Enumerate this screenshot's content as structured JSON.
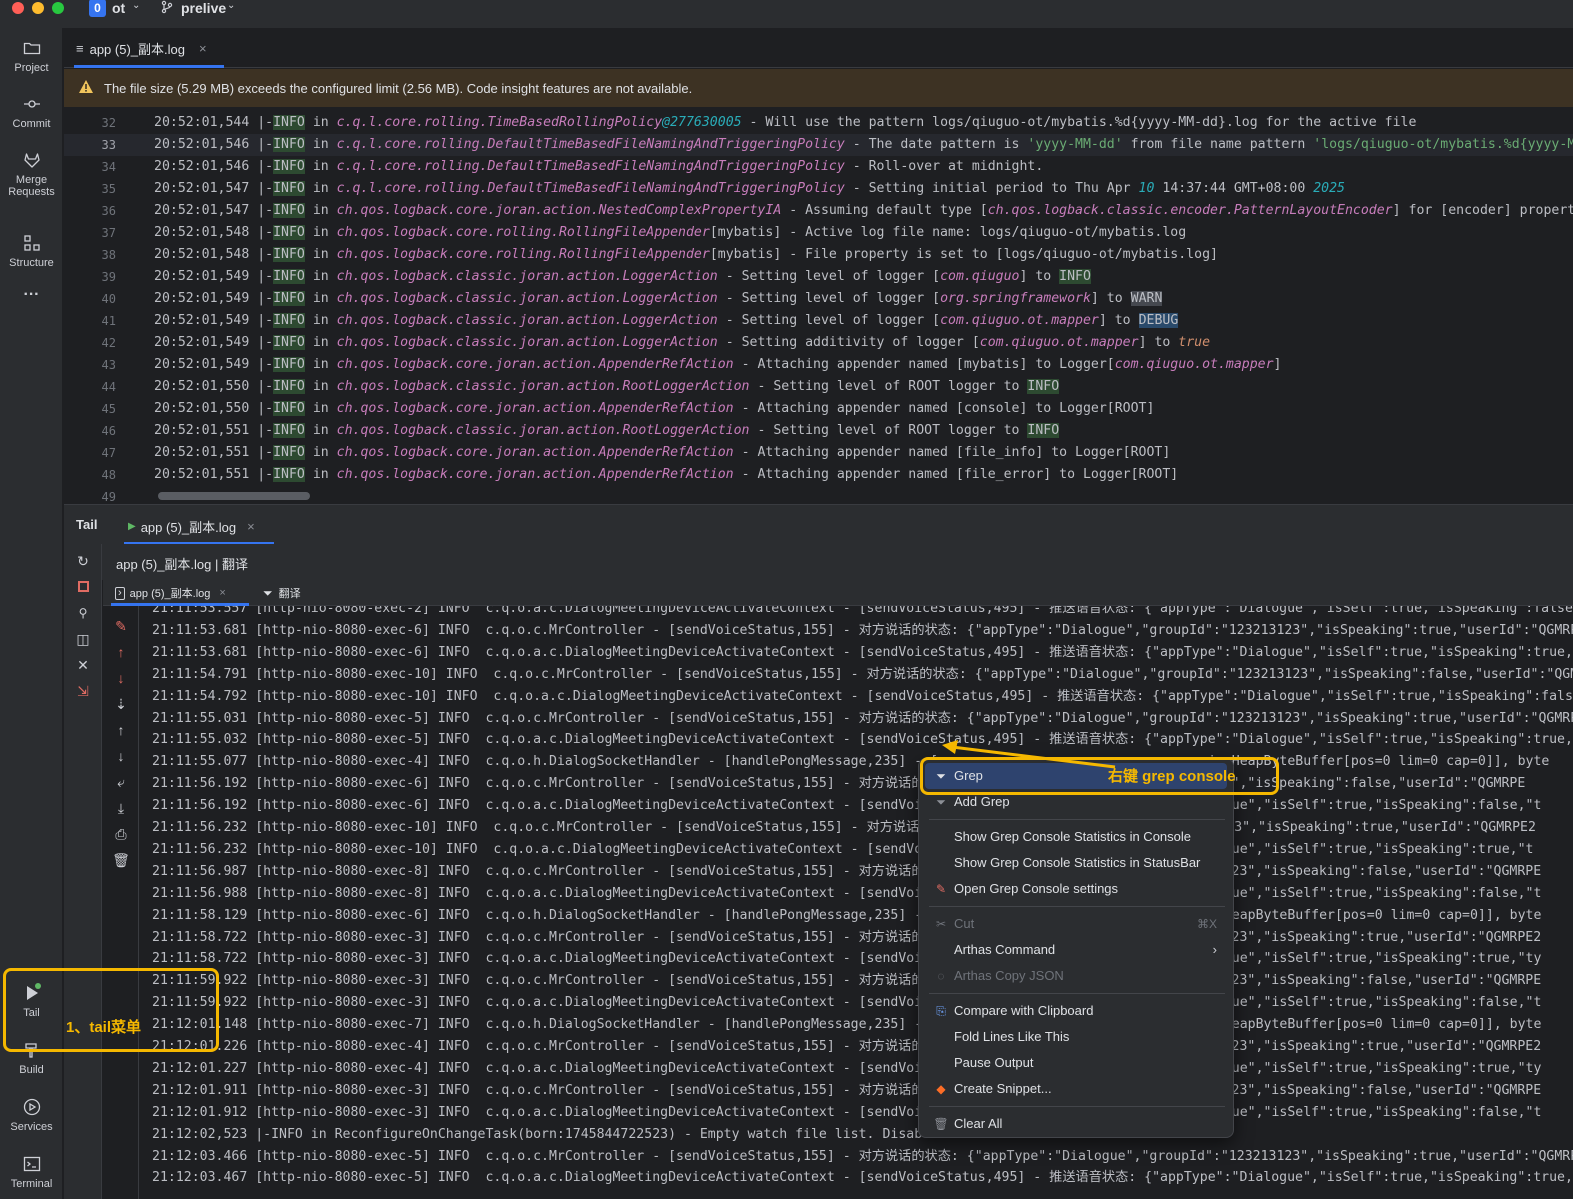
{
  "titlebar": {
    "project_badge": "0",
    "project_name": "ot",
    "branch": "prelive"
  },
  "toolstripe": {
    "project": "Project",
    "commit": "Commit",
    "merge_requests_1": "Merge",
    "merge_requests_2": "Requests",
    "structure": "Structure",
    "more": "···",
    "tail": "Tail",
    "build": "Build",
    "services": "Services",
    "terminal": "Terminal"
  },
  "editor_tab": {
    "label": "app (5)_副本.log"
  },
  "warning": {
    "text": "The file size (5.29 MB) exceeds the configured limit (2.56 MB). Code insight features are not available."
  },
  "editor_lines": [
    {
      "n": "32",
      "t": "20:52:01,544",
      "cls": "c.q.l.core.rolling.TimeBasedRollingPolicy",
      "num": "@277630005",
      "msg": " - Will use the pattern logs/qiuguo-ot/mybatis.%d{yyyy-MM-dd}.log for the active file"
    },
    {
      "n": "33",
      "t": "20:52:01,546",
      "cls": "c.q.l.core.rolling.DefaultTimeBasedFileNamingAndTriggeringPolicy",
      "msg": " - The date pattern is ",
      "s1": "'yyyy-MM-dd'",
      "msg2": " from file name pattern ",
      "s2": "'logs/qiuguo-ot/mybatis.%d{yyyy-MM-d"
    },
    {
      "n": "34",
      "t": "20:52:01,546",
      "cls": "c.q.l.core.rolling.DefaultTimeBasedFileNamingAndTriggeringPolicy",
      "msg": " - Roll-over at midnight."
    },
    {
      "n": "35",
      "t": "20:52:01,547",
      "cls": "c.q.l.core.rolling.DefaultTimeBasedFileNamingAndTriggeringPolicy",
      "msg": " - Setting initial period to Thu Apr ",
      "num1": "10",
      "msg2": " 14:37:44 GMT+08:00 ",
      "num2": "2025"
    },
    {
      "n": "36",
      "t": "20:52:01,547",
      "cls": "ch.qos.logback.core.joran.action.NestedComplexPropertyIA",
      "msg": " - Assuming default type [",
      "cls2": "ch.qos.logback.classic.encoder.PatternLayoutEncoder",
      "msg2": "] for [encoder] property"
    },
    {
      "n": "37",
      "t": "20:52:01,548",
      "cls": "ch.qos.logback.core.rolling.RollingFileAppender",
      "msg": "[mybatis] - Active log file name: logs/qiuguo-ot/mybatis.log"
    },
    {
      "n": "38",
      "t": "20:52:01,548",
      "cls": "ch.qos.logback.core.rolling.RollingFileAppender",
      "msg": "[mybatis] - File property is set to [logs/qiuguo-ot/mybatis.log]"
    },
    {
      "n": "39",
      "t": "20:52:01,549",
      "cls": "ch.qos.logback.classic.joran.action.LoggerAction",
      "msg": " - Setting level of logger [",
      "cls2": "com.qiuguo",
      "msg2": "] to ",
      "tag": "INFO",
      "tagc": "hl-info"
    },
    {
      "n": "40",
      "t": "20:52:01,549",
      "cls": "ch.qos.logback.classic.joran.action.LoggerAction",
      "msg": " - Setting level of logger [",
      "cls2": "org.springframework",
      "msg2": "] to ",
      "tag": "WARN",
      "tagc": "hl-warn"
    },
    {
      "n": "41",
      "t": "20:52:01,549",
      "cls": "ch.qos.logback.classic.joran.action.LoggerAction",
      "msg": " - Setting level of logger [",
      "cls2": "com.qiuguo.ot.mapper",
      "msg2": "] to ",
      "tag": "DEBUG",
      "tagc": "hl-debug"
    },
    {
      "n": "42",
      "t": "20:52:01,549",
      "cls": "ch.qos.logback.classic.joran.action.LoggerAction",
      "msg": " - Setting additivity of logger [",
      "cls2": "com.qiuguo.ot.mapper",
      "msg2": "] to ",
      "kw": "true"
    },
    {
      "n": "43",
      "t": "20:52:01,549",
      "cls": "ch.qos.logback.core.joran.action.AppenderRefAction",
      "msg": " - Attaching appender named [mybatis] to Logger[",
      "cls2": "com.qiuguo.ot.mapper",
      "msg2": "]"
    },
    {
      "n": "44",
      "t": "20:52:01,550",
      "cls": "ch.qos.logback.classic.joran.action.RootLoggerAction",
      "msg": " - Setting level of ROOT logger to ",
      "tag": "INFO",
      "tagc": "hl-info"
    },
    {
      "n": "45",
      "t": "20:52:01,550",
      "cls": "ch.qos.logback.core.joran.action.AppenderRefAction",
      "msg": " - Attaching appender named [console] to Logger[ROOT]"
    },
    {
      "n": "46",
      "t": "20:52:01,551",
      "cls": "ch.qos.logback.classic.joran.action.RootLoggerAction",
      "msg": " - Setting level of ROOT logger to ",
      "tag": "INFO",
      "tagc": "hl-info"
    },
    {
      "n": "47",
      "t": "20:52:01,551",
      "cls": "ch.qos.logback.core.joran.action.AppenderRefAction",
      "msg": " - Attaching appender named [file_info] to Logger[ROOT]"
    },
    {
      "n": "48",
      "t": "20:52:01,551",
      "cls": "ch.qos.logback.core.joran.action.AppenderRefAction",
      "msg": " - Attaching appender named [file_error] to Logger[ROOT]"
    },
    {
      "n": "49"
    }
  ],
  "editor_level_prefix": " |-",
  "editor_level": "INFO",
  "editor_in": " in ",
  "tail": {
    "tab_title": "Tail",
    "tab_label": "app (5)_副本.log",
    "subtitle": "app (5)_副本.log | 翻译",
    "console_tab": "app (5)_副本.log",
    "filter_tab": "翻译"
  },
  "console_lines": [
    "21:11:53.557 [http-nio-8080-exec-2] INFO  c.q.o.a.c.DialogMeetingDeviceActivateContext - [sendVoiceStatus,495] - 推送语音状态: {\"appType\":\"Dialogue\",\"isSelf\":true,\"isSpeaking\":false,\"t",
    "21:11:53.681 [http-nio-8080-exec-6] INFO  c.q.o.c.MrController - [sendVoiceStatus,155] - 对方说话的状态: {\"appType\":\"Dialogue\",\"groupId\":\"123213123\",\"isSpeaking\":true,\"userId\":\"QGMRPE2",
    "21:11:53.681 [http-nio-8080-exec-6] INFO  c.q.o.a.c.DialogMeetingDeviceActivateContext - [sendVoiceStatus,495] - 推送语音状态: {\"appType\":\"Dialogue\",\"isSelf\":true,\"isSpeaking\":true,\"ty",
    "21:11:54.791 [http-nio-8080-exec-10] INFO  c.q.o.c.MrController - [sendVoiceStatus,155] - 对方说话的状态: {\"appType\":\"Dialogue\",\"groupId\":\"123213123\",\"isSpeaking\":false,\"userId\":\"QGMRP",
    "21:11:54.792 [http-nio-8080-exec-10] INFO  c.q.o.a.c.DialogMeetingDeviceActivateContext - [sendVoiceStatus,495] - 推送语音状态: {\"appType\":\"Dialogue\",\"isSelf\":true,\"isSpeaking\":false,\"",
    "21:11:55.031 [http-nio-8080-exec-5] INFO  c.q.o.c.MrController - [sendVoiceStatus,155] - 对方说话的状态: {\"appType\":\"Dialogue\",\"groupId\":\"123213123\",\"isSpeaking\":true,\"userId\":\"QGMRPE2",
    "21:11:55.032 [http-nio-8080-exec-5] INFO  c.q.o.a.c.DialogMeetingDeviceActivateContext - [sendVoiceStatus,495] - 推送语音状态: {\"appType\":\"Dialogue\",\"isSelf\":true,\"isSpeaking\":true,\"ty",
    "21:11:55.077 [http-nio-8080-exec-4] INFO  c.q.o.h.DialogSocketHandler - [handlePongMessage,235] - [                                  io.HeapByteBuffer[pos=0 lim=0 cap=0]], byte",
    "21:11:56.192 [http-nio-8080-exec-6] INFO  c.q.o.c.MrController - [sendVoiceStatus,155] - 对方说话的状                                  123\",\"isSpeaking\":false,\"userId\":\"QGMRPE",
    "21:11:56.192 [http-nio-8080-exec-6] INFO  c.q.o.a.c.DialogMeetingDeviceActivateContext - [sendVoic                                  alogue\",\"isSelf\":true,\"isSpeaking\":false,\"t",
    "21:11:56.232 [http-nio-8080-exec-10] INFO  c.q.o.c.MrController - [sendVoiceStatus,155] - 对方说话的                                  13123\",\"isSpeaking\":true,\"userId\":\"QGMRPE2",
    "21:11:56.232 [http-nio-8080-exec-10] INFO  c.q.o.a.c.DialogMeetingDeviceActivateContext - [sendVoic                                 alogue\",\"isSelf\":true,\"isSpeaking\":true,\"t",
    "21:11:56.987 [http-nio-8080-exec-8] INFO  c.q.o.c.MrController - [sendVoiceStatus,155] - 对方说话的状                                  13123\",\"isSpeaking\":false,\"userId\":\"QGMRPE",
    "21:11:56.988 [http-nio-8080-exec-8] INFO  c.q.o.a.c.DialogMeetingDeviceActivateContext - [sendVoic                                  alogue\",\"isSelf\":true,\"isSpeaking\":false,\"t",
    "21:11:58.129 [http-nio-8080-exec-6] INFO  c.q.o.h.DialogSocketHandler - [handlePongMessage,235] -                                   io.HeapByteBuffer[pos=0 lim=0 cap=0]], byte",
    "21:11:58.722 [http-nio-8080-exec-3] INFO  c.q.o.c.MrController - [sendVoiceStatus,155] - 对方说话的状                                  13123\",\"isSpeaking\":true,\"userId\":\"QGMRPE2",
    "21:11:58.722 [http-nio-8080-exec-3] INFO  c.q.o.a.c.DialogMeetingDeviceActivateContext - [sendVoic                                  alogue\",\"isSelf\":true,\"isSpeaking\":true,\"ty",
    "21:11:59.922 [http-nio-8080-exec-3] INFO  c.q.o.c.MrController - [sendVoiceStatus,155] - 对方说话的状                                  13123\",\"isSpeaking\":false,\"userId\":\"QGMRPE",
    "21:11:59.922 [http-nio-8080-exec-3] INFO  c.q.o.a.c.DialogMeetingDeviceActivateContext - [sendVoic                                  alogue\",\"isSelf\":true,\"isSpeaking\":false,\"t",
    "21:12:01.148 [http-nio-8080-exec-7] INFO  c.q.o.h.DialogSocketHandler - [handlePongMessage,235] -                                   io.HeapByteBuffer[pos=0 lim=0 cap=0]], byte",
    "21:12:01.226 [http-nio-8080-exec-4] INFO  c.q.o.c.MrController - [sendVoiceStatus,155] - 对方说话的状                                  13123\",\"isSpeaking\":true,\"userId\":\"QGMRPE2",
    "21:12:01.227 [http-nio-8080-exec-4] INFO  c.q.o.a.c.DialogMeetingDeviceActivateContext - [sendVoic                                  alogue\",\"isSelf\":true,\"isSpeaking\":true,\"ty",
    "21:12:01.911 [http-nio-8080-exec-3] INFO  c.q.o.c.MrController - [sendVoiceStatus,155] - 对方说话的状                                  13123\",\"isSpeaking\":false,\"userId\":\"QGMRPE",
    "21:12:01.912 [http-nio-8080-exec-3] INFO  c.q.o.a.c.DialogMeetingDeviceActivateContext - [sendVoic                                  alogue\",\"isSelf\":true,\"isSpeaking\":false,\"t",
    "21:12:02,523 |-INFO in ReconfigureOnChangeTask(born:1745844722523) - Empty watch file list. Disabl",
    "21:12:03.466 [http-nio-8080-exec-5] INFO  c.q.o.c.MrController - [sendVoiceStatus,155] - 对方说话的状态: {\"appType\":\"Dialogue\",\"groupId\":\"123213123\",\"isSpeaking\":true,\"userId\":\"QGMRPE2",
    "21:12:03.467 [http-nio-8080-exec-5] INFO  c.q.o.a.c.DialogMeetingDeviceActivateContext - [sendVoiceStatus,495] - 推送语音状态: {\"appType\":\"Dialogue\",\"isSelf\":true,\"isSpeaking\":true,\"ty"
  ],
  "context_menu": {
    "grep": "Grep",
    "add_grep": "Add Grep",
    "stats_console": "Show Grep Console Statistics in Console",
    "stats_statusbar": "Show Grep Console Statistics in StatusBar",
    "open_settings": "Open Grep Console settings",
    "cut": "Cut",
    "cut_shortcut": "⌘X",
    "arthas_command": "Arthas Command",
    "arthas_copy_json": "Arthas Copy JSON",
    "compare_clipboard": "Compare with Clipboard",
    "fold_lines": "Fold Lines Like This",
    "pause_output": "Pause Output",
    "create_snippet": "Create Snippet...",
    "clear_all": "Clear All"
  },
  "annotations": {
    "grep_note": "右键 grep console",
    "tail_note": "1、tail菜单"
  },
  "colors": {
    "accent": "#3574f0",
    "annotation": "#f5b800",
    "warning_bg": "#3d3223",
    "menu_selected": "#2e436e"
  }
}
